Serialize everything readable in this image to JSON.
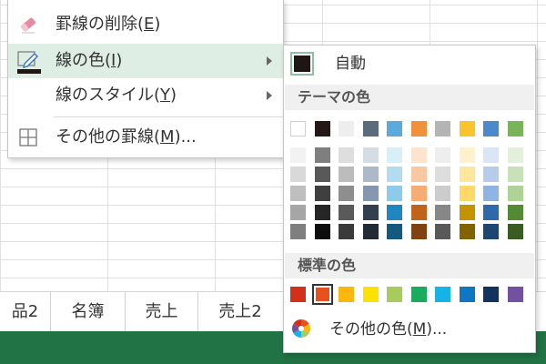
{
  "sheet_tabs": [
    "品2",
    "名簿",
    "売上",
    "売上2"
  ],
  "menu": {
    "items": [
      {
        "label": "罫線の削除(",
        "key": "E",
        "suffix": ")",
        "icon": "eraser-icon"
      },
      {
        "label": "線の色(",
        "key": "I",
        "suffix": ")",
        "icon": "pen-color-icon"
      },
      {
        "label": "線のスタイル(",
        "key": "Y",
        "suffix": ")",
        "icon": ""
      },
      {
        "label": "その他の罫線(",
        "key": "M",
        "suffix": ")...",
        "icon": "borders-grid-icon"
      }
    ]
  },
  "colors": {
    "accent_status_bar": "#217346",
    "highlight": "#dfeee4",
    "current_line_color": "#1f1515"
  },
  "submenu": {
    "auto_label": "自動",
    "theme_heading": "テーマの色",
    "standard_heading": "標準の色",
    "more_colors": {
      "label": "その他の色(",
      "key": "M",
      "suffix": ")..."
    },
    "theme_colors": [
      "#ffffff",
      "#231815",
      "#eeeeee",
      "#5b6b7e",
      "#5aaadc",
      "#f0913c",
      "#b4b4b4",
      "#fcc42c",
      "#4a8acb",
      "#7ab45a"
    ],
    "theme_shades": [
      [
        "#f2f2f2",
        "#d9d9d9",
        "#bfbfbf",
        "#a6a6a6",
        "#7f7f7f"
      ],
      [
        "#7f7f7f",
        "#595959",
        "#3f3f3f",
        "#262626",
        "#0d0d0d"
      ],
      [
        "#dedede",
        "#bcbcbc",
        "#8e8e8e",
        "#5a5a5a",
        "#3a3a3a"
      ],
      [
        "#d6dce4",
        "#adb9ca",
        "#8496b0",
        "#323f4f",
        "#222a35"
      ],
      [
        "#daeef8",
        "#b4dcf1",
        "#8ecbeb",
        "#1f86c0",
        "#155980"
      ],
      [
        "#fce4d1",
        "#f9c8a2",
        "#f6ac74",
        "#c0641b",
        "#7f4212"
      ],
      [
        "#eeeeee",
        "#dddddd",
        "#cccccc",
        "#878787",
        "#595959"
      ],
      [
        "#fff2cc",
        "#fee69a",
        "#fed967",
        "#c49400",
        "#836300"
      ],
      [
        "#dae6f5",
        "#b5cdeb",
        "#90b4e1",
        "#2c6aab",
        "#1d4772"
      ],
      [
        "#e4f0dc",
        "#c9e1b9",
        "#afd296",
        "#548a34",
        "#385c23"
      ]
    ],
    "standard_colors": [
      "#d32f1a",
      "#e8501e",
      "#fbb710",
      "#fde100",
      "#a6cc5b",
      "#1aab5e",
      "#16b3e8",
      "#0f77c2",
      "#12325f",
      "#7450a1"
    ],
    "standard_selected_index": 1
  }
}
